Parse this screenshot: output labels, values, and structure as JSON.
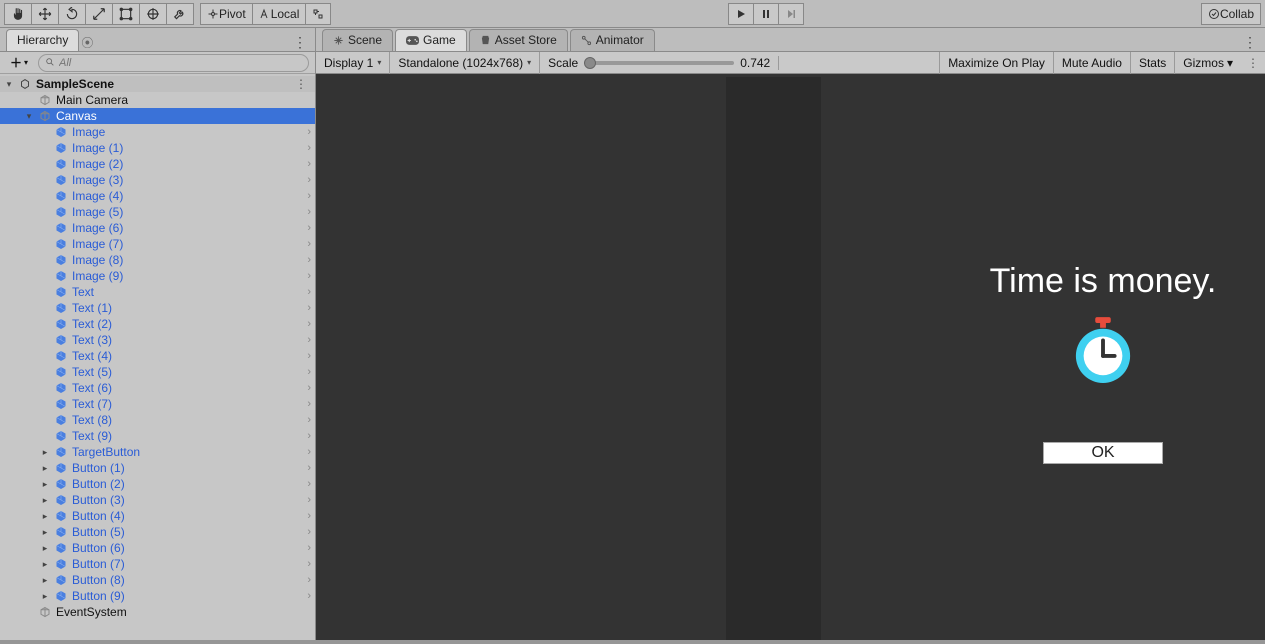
{
  "toolbar": {
    "pivot_label": "Pivot",
    "local_label": "Local",
    "collab_label": "Collab"
  },
  "tabs": {
    "hierarchy_label": "Hierarchy",
    "scene_label": "Scene",
    "game_label": "Game",
    "asset_store_label": "Asset Store",
    "animator_label": "Animator"
  },
  "hierarchy": {
    "search_placeholder": "All",
    "scene_name": "SampleScene",
    "items": [
      {
        "label": "Main Camera",
        "type": "go",
        "depth": 1
      },
      {
        "label": "Canvas",
        "type": "go",
        "depth": 1,
        "selected": true,
        "expanded": true
      },
      {
        "label": "Image",
        "type": "prefab",
        "depth": 2,
        "chev": true
      },
      {
        "label": "Image (1)",
        "type": "prefab",
        "depth": 2,
        "chev": true
      },
      {
        "label": "Image (2)",
        "type": "prefab",
        "depth": 2,
        "chev": true
      },
      {
        "label": "Image (3)",
        "type": "prefab",
        "depth": 2,
        "chev": true
      },
      {
        "label": "Image (4)",
        "type": "prefab",
        "depth": 2,
        "chev": true
      },
      {
        "label": "Image (5)",
        "type": "prefab",
        "depth": 2,
        "chev": true
      },
      {
        "label": "Image (6)",
        "type": "prefab",
        "depth": 2,
        "chev": true
      },
      {
        "label": "Image (7)",
        "type": "prefab",
        "depth": 2,
        "chev": true
      },
      {
        "label": "Image (8)",
        "type": "prefab",
        "depth": 2,
        "chev": true
      },
      {
        "label": "Image (9)",
        "type": "prefab",
        "depth": 2,
        "chev": true
      },
      {
        "label": "Text",
        "type": "prefab",
        "depth": 2,
        "chev": true
      },
      {
        "label": "Text (1)",
        "type": "prefab",
        "depth": 2,
        "chev": true
      },
      {
        "label": "Text (2)",
        "type": "prefab",
        "depth": 2,
        "chev": true
      },
      {
        "label": "Text (3)",
        "type": "prefab",
        "depth": 2,
        "chev": true
      },
      {
        "label": "Text (4)",
        "type": "prefab",
        "depth": 2,
        "chev": true
      },
      {
        "label": "Text (5)",
        "type": "prefab",
        "depth": 2,
        "chev": true
      },
      {
        "label": "Text (6)",
        "type": "prefab",
        "depth": 2,
        "chev": true
      },
      {
        "label": "Text (7)",
        "type": "prefab",
        "depth": 2,
        "chev": true
      },
      {
        "label": "Text (8)",
        "type": "prefab",
        "depth": 2,
        "chev": true
      },
      {
        "label": "Text (9)",
        "type": "prefab",
        "depth": 2,
        "chev": true
      },
      {
        "label": "TargetButton",
        "type": "prefab",
        "depth": 2,
        "fold": true,
        "chev": true
      },
      {
        "label": "Button (1)",
        "type": "prefab",
        "depth": 2,
        "fold": true,
        "chev": true
      },
      {
        "label": "Button (2)",
        "type": "prefab",
        "depth": 2,
        "fold": true,
        "chev": true
      },
      {
        "label": "Button (3)",
        "type": "prefab",
        "depth": 2,
        "fold": true,
        "chev": true
      },
      {
        "label": "Button (4)",
        "type": "prefab",
        "depth": 2,
        "fold": true,
        "chev": true
      },
      {
        "label": "Button (5)",
        "type": "prefab",
        "depth": 2,
        "fold": true,
        "chev": true
      },
      {
        "label": "Button (6)",
        "type": "prefab",
        "depth": 2,
        "fold": true,
        "chev": true
      },
      {
        "label": "Button (7)",
        "type": "prefab",
        "depth": 2,
        "fold": true,
        "chev": true
      },
      {
        "label": "Button (8)",
        "type": "prefab",
        "depth": 2,
        "fold": true,
        "chev": true
      },
      {
        "label": "Button (9)",
        "type": "prefab",
        "depth": 2,
        "fold": true,
        "chev": true
      },
      {
        "label": "EventSystem",
        "type": "go",
        "depth": 1
      }
    ]
  },
  "game_header": {
    "display_label": "Display 1",
    "resolution_label": "Standalone (1024x768)",
    "scale_label": "Scale",
    "scale_value": "0.742",
    "maximize_label": "Maximize On Play",
    "mute_label": "Mute Audio",
    "stats_label": "Stats",
    "gizmos_label": "Gizmos"
  },
  "game_content": {
    "headline": "Time is money.",
    "button_label": "OK"
  }
}
